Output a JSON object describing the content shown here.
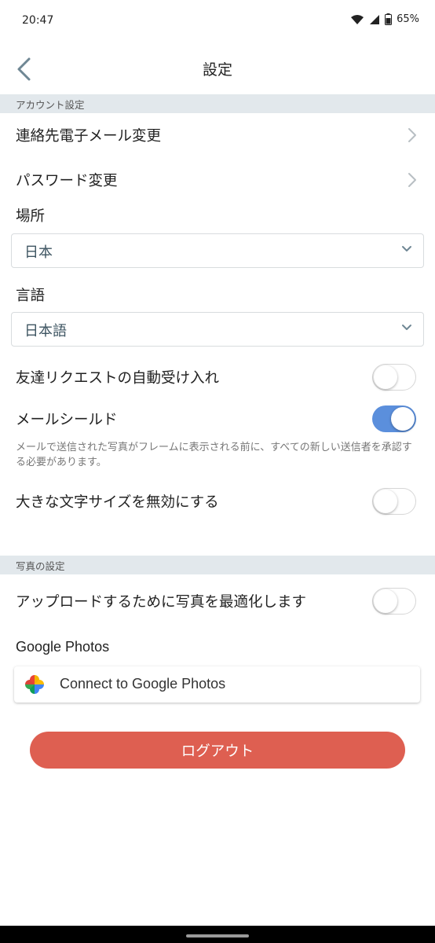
{
  "status_bar": {
    "time": "20:47",
    "battery": "65%",
    "icons": [
      "wifi-icon",
      "signal-icon",
      "battery-icon"
    ]
  },
  "header": {
    "back_icon": "chevron-left-icon",
    "title": "設定"
  },
  "account_section": {
    "header": "アカウント設定",
    "change_email_label": "連絡先電子メール変更",
    "change_password_label": "パスワード変更",
    "location_label": "場所",
    "location_value": "日本",
    "language_label": "言語",
    "language_value": "日本語",
    "auto_accept_label": "友達リクエストの自動受け入れ",
    "auto_accept_on": false,
    "mail_shield_label": "メールシールド",
    "mail_shield_on": true,
    "mail_shield_hint": "メールで送信された写真がフレームに表示される前に、すべての新しい送信者を承認する必要があります。",
    "disable_large_text_label": "大きな文字サイズを無効にする",
    "disable_large_text_on": false
  },
  "photo_section": {
    "header": "写真の設定",
    "optimize_upload_label": "アップロードするために写真を最適化します",
    "optimize_upload_on": false,
    "google_photos_label": "Google Photos",
    "google_photos_button": "Connect to Google Photos"
  },
  "logout_label": "ログアウト",
  "colors": {
    "accent_toggle": "#5b8fdc",
    "logout": "#de5f51",
    "section_header_bg": "#e2e8ec"
  }
}
